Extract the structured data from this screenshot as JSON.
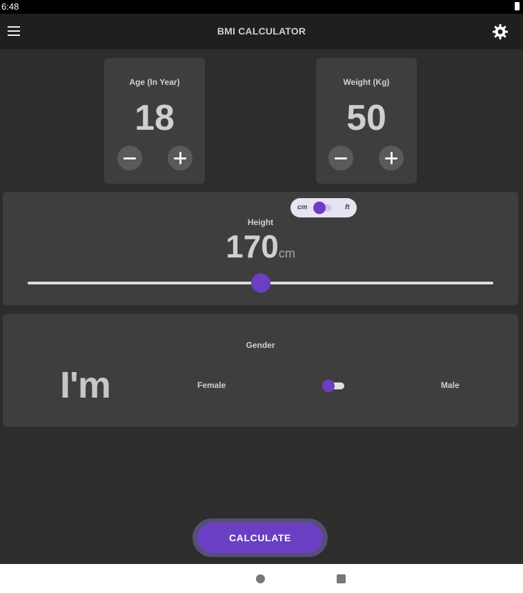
{
  "status_bar": {
    "time": "6:48",
    "battery_icon": "battery-icon"
  },
  "app_bar": {
    "title": "BMI CALCULATOR",
    "menu_icon": "menu-icon",
    "theme_icon": "gear-icon"
  },
  "age_card": {
    "label": "Age (In Year)",
    "value": "18",
    "decrement_icon": "minus-icon",
    "increment_icon": "plus-icon"
  },
  "weight_card": {
    "label": "Weight (Kg)",
    "value": "50",
    "decrement_icon": "minus-icon",
    "increment_icon": "plus-icon"
  },
  "height_card": {
    "label": "Height",
    "value": "170",
    "unit": "cm",
    "unit_toggle": {
      "left_label": "cm",
      "right_label": "ft",
      "selected": "cm"
    },
    "slider_fraction": 0.5
  },
  "gender_card": {
    "label": "Gender",
    "prefix": "I'm",
    "female_label": "Female",
    "male_label": "Male",
    "selected": "Female"
  },
  "calculate_button": {
    "label": "CALCULATE"
  },
  "colors": {
    "accent": "#6a3fc4",
    "background": "#2d2d2d",
    "card": "#3e3e3e",
    "app_bar": "#1f1f1f"
  }
}
